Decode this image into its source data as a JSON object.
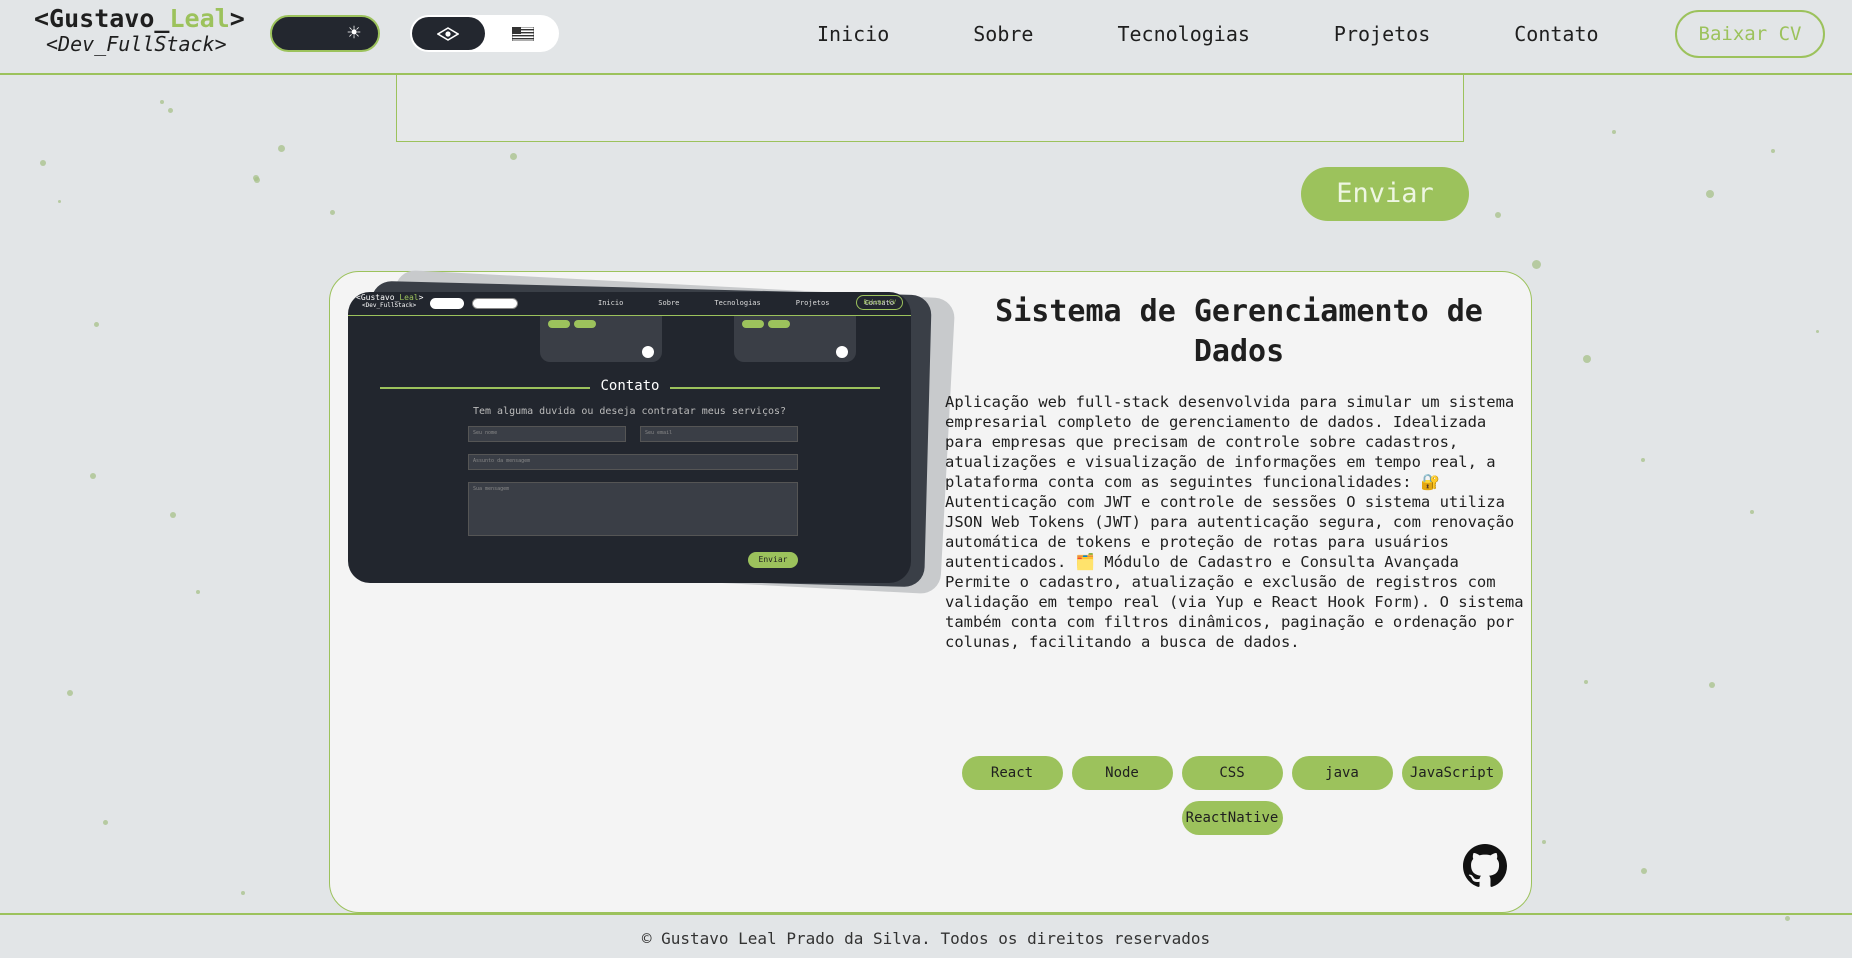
{
  "header": {
    "logo_prefix": "<Gustavo_",
    "logo_accent": "Leal",
    "logo_suffix": ">",
    "logo_subtitle": "<Dev_FullStack>",
    "theme_icon": "sun-icon",
    "lang_flags": [
      "brazil-flag",
      "us-flag"
    ],
    "nav": [
      "Inicio",
      "Sobre",
      "Tecnologias",
      "Projetos",
      "Contato"
    ],
    "cv_button": "Baixar CV"
  },
  "form": {
    "send_button": "Enviar"
  },
  "project": {
    "title": "Sistema de Gerenciamento de Dados",
    "description": "Aplicação web full-stack desenvolvida para simular um sistema empresarial completo de gerenciamento de dados. Idealizada para empresas que precisam de controle sobre cadastros, atualizações e visualização de informações em tempo real, a plataforma conta com as seguintes funcionalidades: 🔐 Autenticação com JWT e controle de sessões O sistema utiliza JSON Web Tokens (JWT) para autenticação segura, com renovação automática de tokens e proteção de rotas para usuários autenticados. 🗂️ Módulo de Cadastro e Consulta Avançada Permite o cadastro, atualização e exclusão de registros com validação em tempo real (via Yup e React Hook Form). O sistema também conta com filtros dinâmicos, paginação e ordenação por colunas, facilitando a busca de dados.",
    "tags": [
      "React",
      "Node",
      "CSS",
      "java",
      "JavaScript",
      "ReactNative"
    ],
    "screenshot": {
      "logo_prefix": "<Gustavo_",
      "logo_accent": "Leal",
      "logo_suffix": ">",
      "logo_subtitle": "<Dev_FullStack>",
      "nav": [
        "Inicio",
        "Sobre",
        "Tecnologias",
        "Projetos",
        "Contato"
      ],
      "cv": "Baixar CV",
      "section_title": "Contato",
      "subtitle": "Tem alguma duvida ou deseja contratar meus serviços?",
      "name_placeholder": "Seu nome",
      "email_placeholder": "Seu email",
      "subject_placeholder": "Assunto da mensagem",
      "message_placeholder": "Sua mensagem",
      "send": "Enviar"
    }
  },
  "footer": {
    "text": "© Gustavo Leal Prado da Silva. Todos os direitos reservados"
  },
  "colors": {
    "accent": "#9cc25c",
    "background": "#e2e5e7",
    "dark": "#23272f"
  }
}
